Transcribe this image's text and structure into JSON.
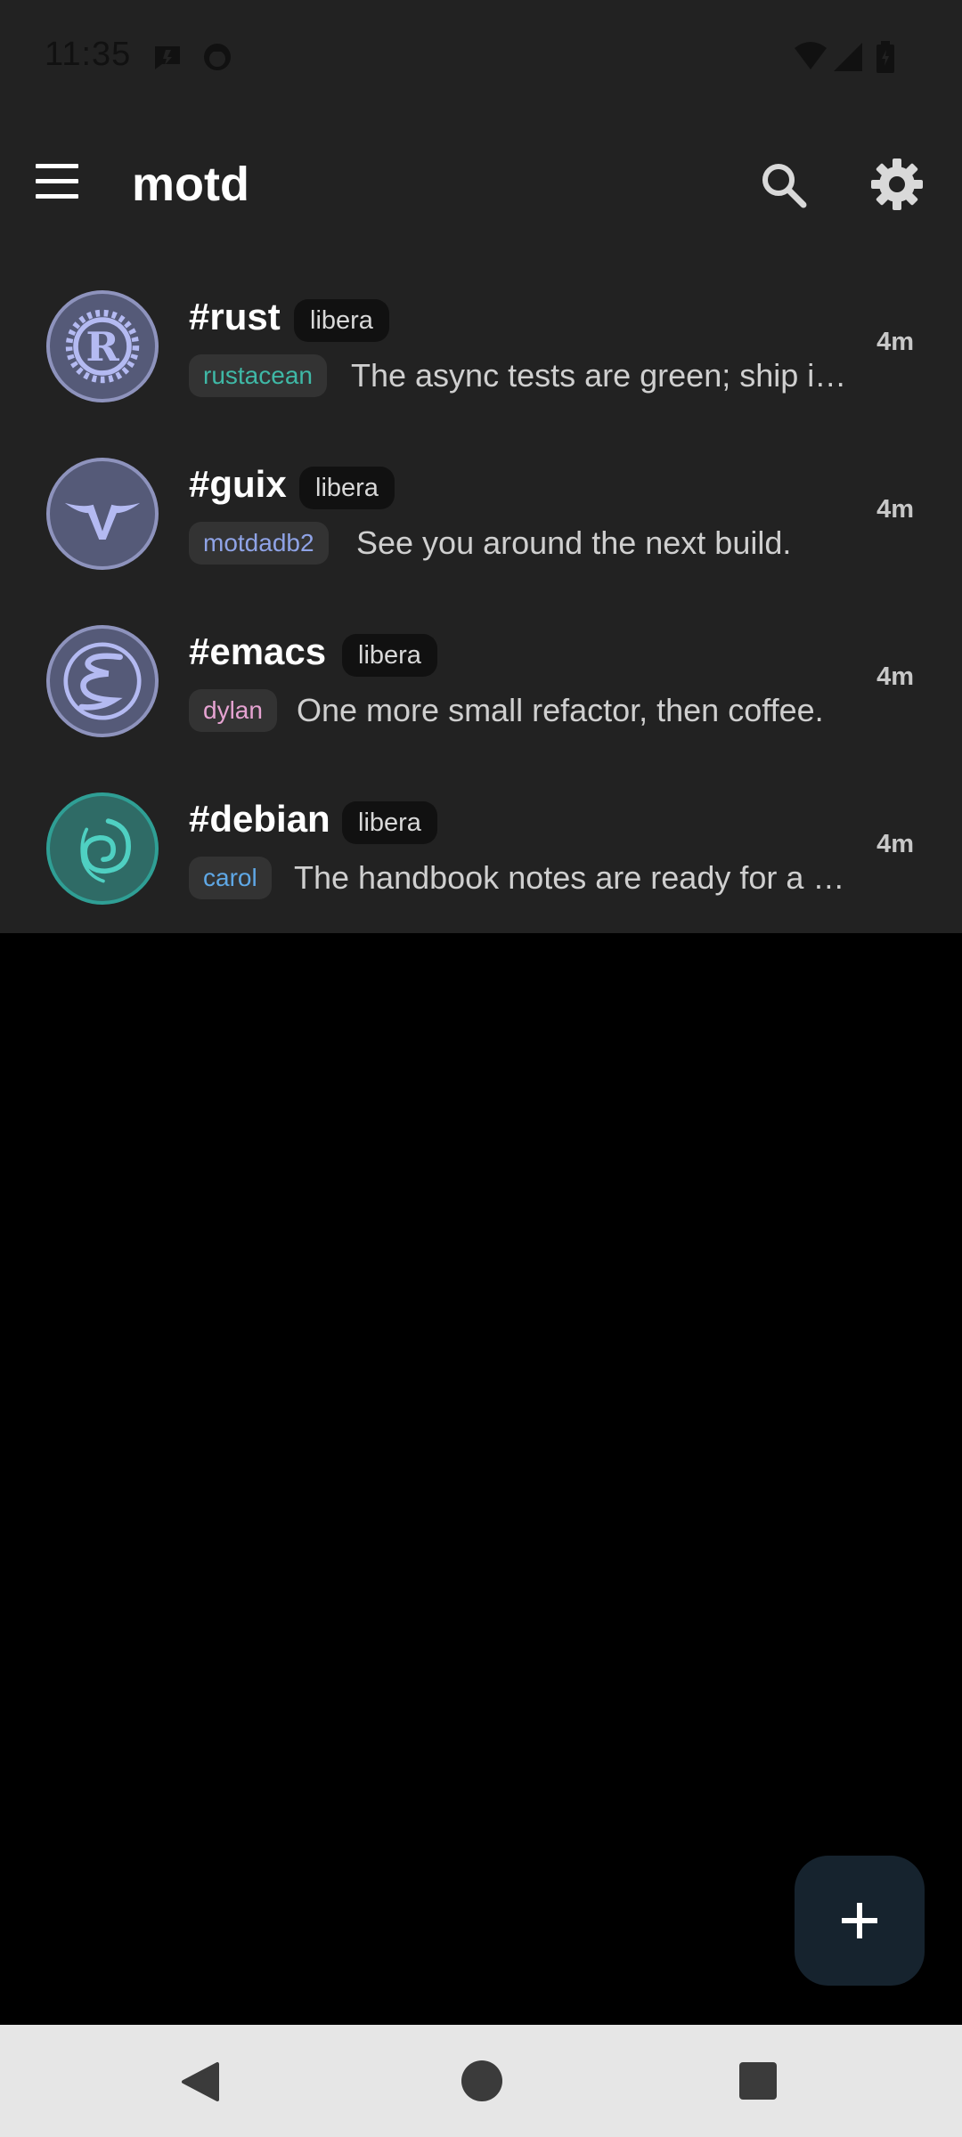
{
  "status_bar": {
    "time": "11:35",
    "icons": [
      "notification-icon",
      "app-notification-icon",
      "wifi-icon",
      "signal-icon",
      "battery-icon"
    ]
  },
  "app_bar": {
    "title": "motd",
    "menu_icon": "menu-icon",
    "search_icon": "search-icon",
    "settings_icon": "gear-icon"
  },
  "channels": [
    {
      "name": "#rust",
      "network": "libera",
      "nick": "rustacean",
      "nick_color": "#3fb8a6",
      "message": "The async tests are green; ship it after lunch.",
      "time": "4m",
      "avatar_icon": "rust-logo-icon"
    },
    {
      "name": "#guix",
      "network": "libera",
      "nick": "motdadb2",
      "nick_color": "#8fa3e6",
      "message": "See you around the next build.",
      "time": "4m",
      "avatar_icon": "guix-logo-icon"
    },
    {
      "name": "#emacs",
      "network": "libera",
      "nick": "dylan",
      "nick_color": "#e6a3d2",
      "message": "One more small refactor, then coffee.",
      "time": "4m",
      "avatar_icon": "emacs-logo-icon"
    },
    {
      "name": "#debian",
      "network": "libera",
      "nick": "carol",
      "nick_color": "#5fa8e6",
      "message": "The handbook notes are ready for a review.",
      "time": "4m",
      "avatar_icon": "debian-logo-icon"
    }
  ],
  "fab": {
    "icon": "plus-icon"
  },
  "nav_bar": {
    "icons": [
      "back-icon",
      "home-icon",
      "recents-icon"
    ]
  },
  "colors": {
    "surface": "#222222",
    "background": "#000000",
    "chip": "#111111",
    "fab": "#16232e"
  }
}
